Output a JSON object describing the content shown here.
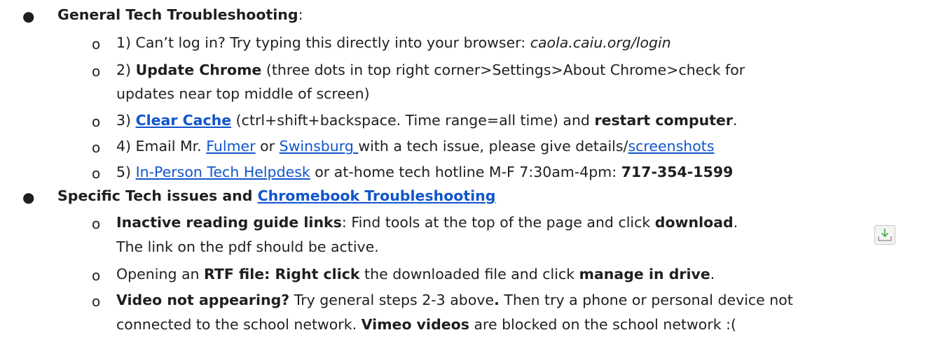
{
  "section1": {
    "bullet": "●",
    "title": "General Tech Troubleshooting",
    "title_suffix": ":",
    "items": [
      {
        "marker": "o",
        "text_pre": "1) Can’t log in? Try typing this directly into your browser: ",
        "url_italic": "caola.caiu.org/login"
      },
      {
        "marker": "o",
        "num": "2) ",
        "bold": "Update Chrome",
        "text": " (three dots in top right corner>Settings>About Chrome>check for",
        "continuation": "updates near top middle of screen)"
      },
      {
        "marker": "o",
        "num": "3) ",
        "link": "Clear Cache",
        "text": " (ctrl+shift+backspace. Time range=all time)  and ",
        "bold": "restart computer",
        "end": "."
      },
      {
        "marker": "o",
        "text_pre": "4) Email Mr. ",
        "link1": "Fulmer",
        "mid": " or ",
        "link2": "Swinsburg ",
        "text_post": "with a tech issue, please give details/",
        "link3": "screenshots"
      },
      {
        "marker": "o",
        "num": "5) ",
        "link": "In-Person Tech Helpdesk",
        "text": " or at-home tech hotline M-F 7:30am-4pm: ",
        "bold": "717-354-1599"
      }
    ]
  },
  "section2": {
    "bullet": "●",
    "title": "Specific Tech issues and ",
    "title_link": "Chromebook Troubleshooting",
    "items": [
      {
        "marker": "o",
        "bold": "Inactive reading guide links",
        "text": ": Find tools at the top of the page and click ",
        "bold2": "download",
        "end": ".",
        "continuation": "The link on the pdf should be active.",
        "icon": "download-icon"
      },
      {
        "marker": "o",
        "text_pre": "Opening an ",
        "bold1": "RTF file: Right click",
        "text": " the downloaded file and click ",
        "bold2": "manage in drive",
        "end": "."
      },
      {
        "marker": "o",
        "bold1": "Video not appearing?",
        "text": " Try general steps 2-3 above",
        "bold_dot": ".",
        "text2": " Then try a phone or personal device not",
        "continuation_pre": "connected to the school network. ",
        "continuation_bold": "Vimeo videos",
        "continuation_post": " are blocked on the school network :("
      }
    ]
  }
}
